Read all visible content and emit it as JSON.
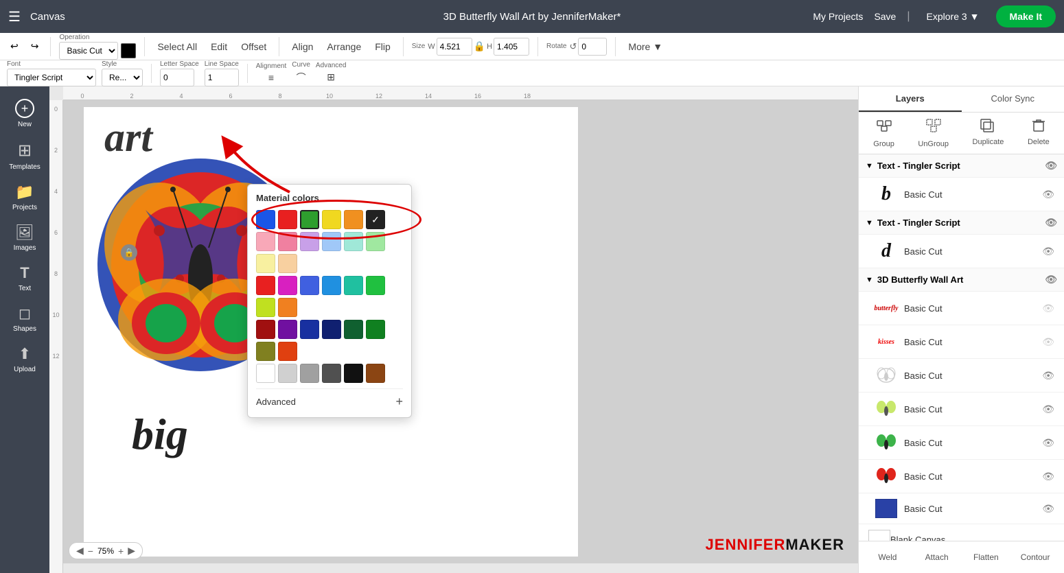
{
  "topnav": {
    "menu_icon": "☰",
    "canvas_label": "Canvas",
    "project_title": "3D Butterfly Wall Art by JenniferMaker*",
    "my_projects": "My Projects",
    "save": "Save",
    "divider": "|",
    "machine": "Explore 3",
    "make_it": "Make It"
  },
  "toolbar1": {
    "undo": "↩",
    "redo": "↪",
    "operation_label": "Operation",
    "operation_value": "Basic Cut",
    "color_swatch": "#000000",
    "select_all": "Select All",
    "edit": "Edit",
    "offset": "Offset",
    "align": "Align",
    "arrange": "Arrange",
    "flip": "Flip",
    "size_label": "Size",
    "width_label": "W",
    "width_value": "4.521",
    "height_label": "H",
    "height_value": "1.405",
    "lock_icon": "🔒",
    "rotate_label": "Rotate",
    "rotate_value": "0",
    "more": "More ▼"
  },
  "toolbar2": {
    "font_label": "Font",
    "font_value": "Tingler Script",
    "style_label": "Style",
    "style_value": "Re...",
    "char_space_label": "Letter Space",
    "char_space_value": "0",
    "line_space_label": "Line Space",
    "line_space_value": "1",
    "alignment_label": "Alignment",
    "curve_label": "Curve",
    "advanced_label": "Advanced"
  },
  "color_picker": {
    "title": "Material colors",
    "row1": [
      "#1a56e8",
      "#e82020",
      "#2e9e2e",
      "#f0d820",
      "#f09020",
      "#222222",
      "#f8f8f8"
    ],
    "row2_checked": "#2e9e2e",
    "advanced_label": "Advanced",
    "plus": "+"
  },
  "left_sidebar": {
    "items": [
      {
        "label": "New",
        "icon": "+"
      },
      {
        "label": "Templates",
        "icon": "⊞"
      },
      {
        "label": "Projects",
        "icon": "📁"
      },
      {
        "label": "Images",
        "icon": "🖼"
      },
      {
        "label": "Text",
        "icon": "T"
      },
      {
        "label": "Shapes",
        "icon": "◻"
      },
      {
        "label": "Upload",
        "icon": "⬆"
      }
    ]
  },
  "right_panel": {
    "tabs": [
      {
        "label": "Layers",
        "active": true
      },
      {
        "label": "Color Sync",
        "active": false
      }
    ],
    "actions": [
      {
        "label": "Group",
        "icon": "⊞",
        "disabled": false
      },
      {
        "label": "UnGroup",
        "icon": "⊟",
        "disabled": false
      },
      {
        "label": "Duplicate",
        "icon": "⧉",
        "disabled": false
      },
      {
        "label": "Delete",
        "icon": "🗑",
        "disabled": false
      }
    ],
    "layer_groups": [
      {
        "name": "Text - Tingler Script",
        "expanded": true,
        "items": [
          {
            "thumb_type": "script_b",
            "name": "Basic Cut",
            "color": "#222222",
            "eye": "visible"
          }
        ]
      },
      {
        "name": "Text - Tingler Script",
        "expanded": true,
        "items": [
          {
            "thumb_type": "script_d",
            "name": "Basic Cut",
            "color": "#222222",
            "eye": "visible"
          }
        ]
      },
      {
        "name": "3D Butterfly Wall Art",
        "expanded": true,
        "items": [
          {
            "thumb_type": "text_butterfly",
            "name": "Basic Cut",
            "color": "#c00",
            "eye": "hidden"
          },
          {
            "thumb_type": "text_kisses",
            "name": "Basic Cut",
            "color": "#e00",
            "eye": "hidden"
          },
          {
            "thumb_type": "butterfly_white",
            "name": "Basic Cut",
            "color": "#ffffff",
            "eye": "visible"
          },
          {
            "thumb_type": "butterfly_lime",
            "name": "Basic Cut",
            "color": "#c8e86c",
            "eye": "visible"
          },
          {
            "thumb_type": "butterfly_green",
            "name": "Basic Cut",
            "color": "#3cb34a",
            "eye": "visible"
          },
          {
            "thumb_type": "butterfly_red",
            "name": "Basic Cut",
            "color": "#e0251c",
            "eye": "visible"
          },
          {
            "thumb_type": "butterfly_blue",
            "name": "Basic Cut",
            "color": "#2941a6",
            "eye": "visible"
          }
        ]
      }
    ],
    "blank_canvas": "Blank Canvas",
    "bottom_buttons": [
      "Weld",
      "Attach",
      "Flatten",
      "Contour"
    ]
  },
  "zoom": {
    "level": "75%",
    "back": "◀",
    "forward": "▶",
    "minus": "−",
    "plus": "+"
  },
  "watermark": "JENNIFERMAKER",
  "ruler": {
    "top_ticks": [
      "0",
      "",
      "2",
      "",
      "4",
      "",
      "6",
      "",
      "8",
      "",
      "10",
      "",
      "12",
      "",
      "14",
      "",
      "16",
      "",
      "18",
      ""
    ],
    "left_ticks": [
      "0",
      "2",
      "4",
      "6",
      "8",
      "10",
      "12"
    ]
  }
}
